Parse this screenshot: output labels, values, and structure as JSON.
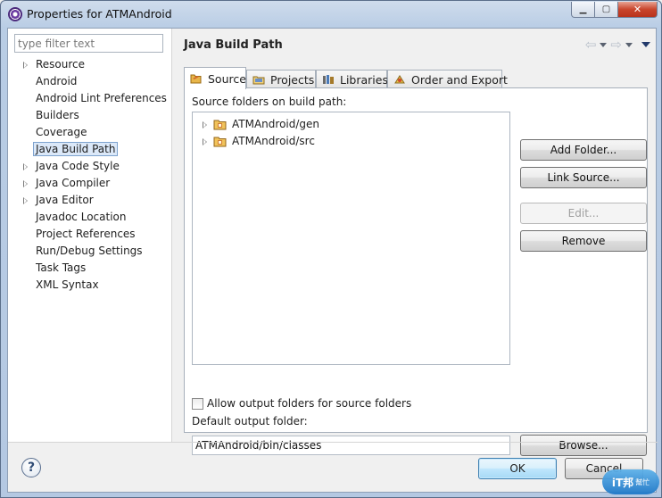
{
  "window": {
    "title": "Properties for ATMAndroid",
    "minimize_glyph": "▁",
    "maximize_glyph": "▢",
    "close_glyph": "✕"
  },
  "filter": {
    "placeholder": "type filter text"
  },
  "tree": {
    "items": [
      {
        "label": "Resource",
        "expandable": true,
        "selected": false
      },
      {
        "label": "Android",
        "expandable": false,
        "selected": false
      },
      {
        "label": "Android Lint Preferences",
        "expandable": false,
        "selected": false
      },
      {
        "label": "Builders",
        "expandable": false,
        "selected": false
      },
      {
        "label": "Coverage",
        "expandable": false,
        "selected": false
      },
      {
        "label": "Java Build Path",
        "expandable": false,
        "selected": true
      },
      {
        "label": "Java Code Style",
        "expandable": true,
        "selected": false
      },
      {
        "label": "Java Compiler",
        "expandable": true,
        "selected": false
      },
      {
        "label": "Java Editor",
        "expandable": true,
        "selected": false
      },
      {
        "label": "Javadoc Location",
        "expandable": false,
        "selected": false
      },
      {
        "label": "Project References",
        "expandable": false,
        "selected": false
      },
      {
        "label": "Run/Debug Settings",
        "expandable": false,
        "selected": false
      },
      {
        "label": "Task Tags",
        "expandable": false,
        "selected": false
      },
      {
        "label": "XML Syntax",
        "expandable": false,
        "selected": false
      }
    ]
  },
  "page": {
    "title": "Java Build Path",
    "back_glyph": "⇦",
    "forward_glyph": "⇨"
  },
  "tabs": [
    {
      "label": "Source",
      "icon": "source-folder-icon",
      "active": true
    },
    {
      "label": "Projects",
      "icon": "projects-icon",
      "active": false
    },
    {
      "label": "Libraries",
      "icon": "libraries-icon",
      "active": false
    },
    {
      "label": "Order and Export",
      "icon": "order-export-icon",
      "active": false
    }
  ],
  "source": {
    "label": "Source folders on build path:",
    "folders": [
      {
        "label": "ATMAndroid/gen"
      },
      {
        "label": "ATMAndroid/src"
      }
    ],
    "buttons": {
      "add_folder": "Add Folder...",
      "link_source": "Link Source...",
      "edit": "Edit...",
      "remove": "Remove"
    },
    "allow_output_label": "Allow output folders for source folders",
    "allow_output_checked": false,
    "default_output_label": "Default output folder:",
    "default_output_value": "ATMAndroid/bin/classes",
    "browse": "Browse..."
  },
  "footer": {
    "help_glyph": "?",
    "ok": "OK",
    "cancel": "Cancel"
  },
  "watermark": {
    "text": "iT邦",
    "sub": "幫忙"
  }
}
